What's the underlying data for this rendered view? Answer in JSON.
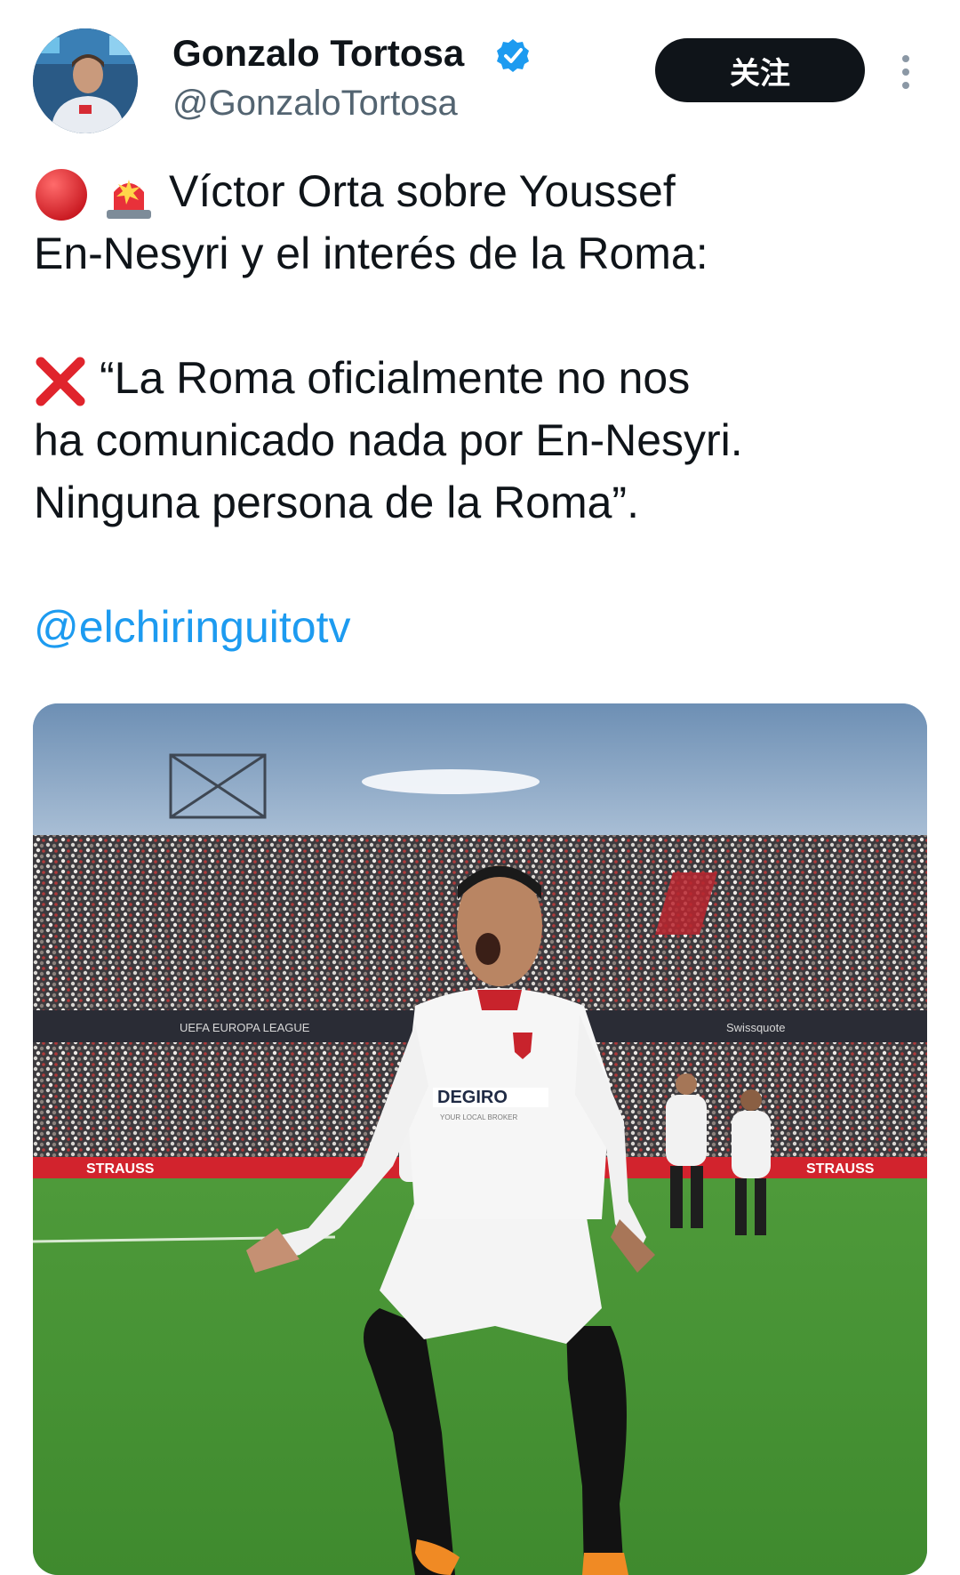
{
  "author": {
    "display_name": "Gonzalo Tortosa",
    "handle": "@GonzaloTortosa",
    "verified": true,
    "avatar_icon": "avatar-photo"
  },
  "follow_button": {
    "label": "关注"
  },
  "more_icon": "more-vertical-icon",
  "tweet": {
    "line1": "Víctor Orta sobre Youssef",
    "line2": "En-Nesyri y el interés de la Roma:",
    "line3": "“La Roma oficialmente no nos",
    "line4": "ha comunicado nada por En-Nesyri.",
    "line5": "Ninguna persona de la Roma”.",
    "mention": "@elchiringuitotv",
    "emojis": [
      "red-circle-icon",
      "rotating-light-icon",
      "cross-mark-icon"
    ]
  },
  "media": {
    "alt_icon": "stadium-celebration-photo",
    "texts": {
      "sponsor": "DEGIRO",
      "sponsor_sub": "YOUR LOCAL BROKER",
      "ad1": "STRAUSS",
      "ad2": "UEFA EUROPA LEAGUE",
      "ad3": "Swissquote",
      "ad4": "STRAUSS"
    }
  },
  "colors": {
    "link": "#1d9bf0",
    "verified": "#1d9bf0",
    "button_bg": "#0f1419",
    "handle": "#536471"
  }
}
